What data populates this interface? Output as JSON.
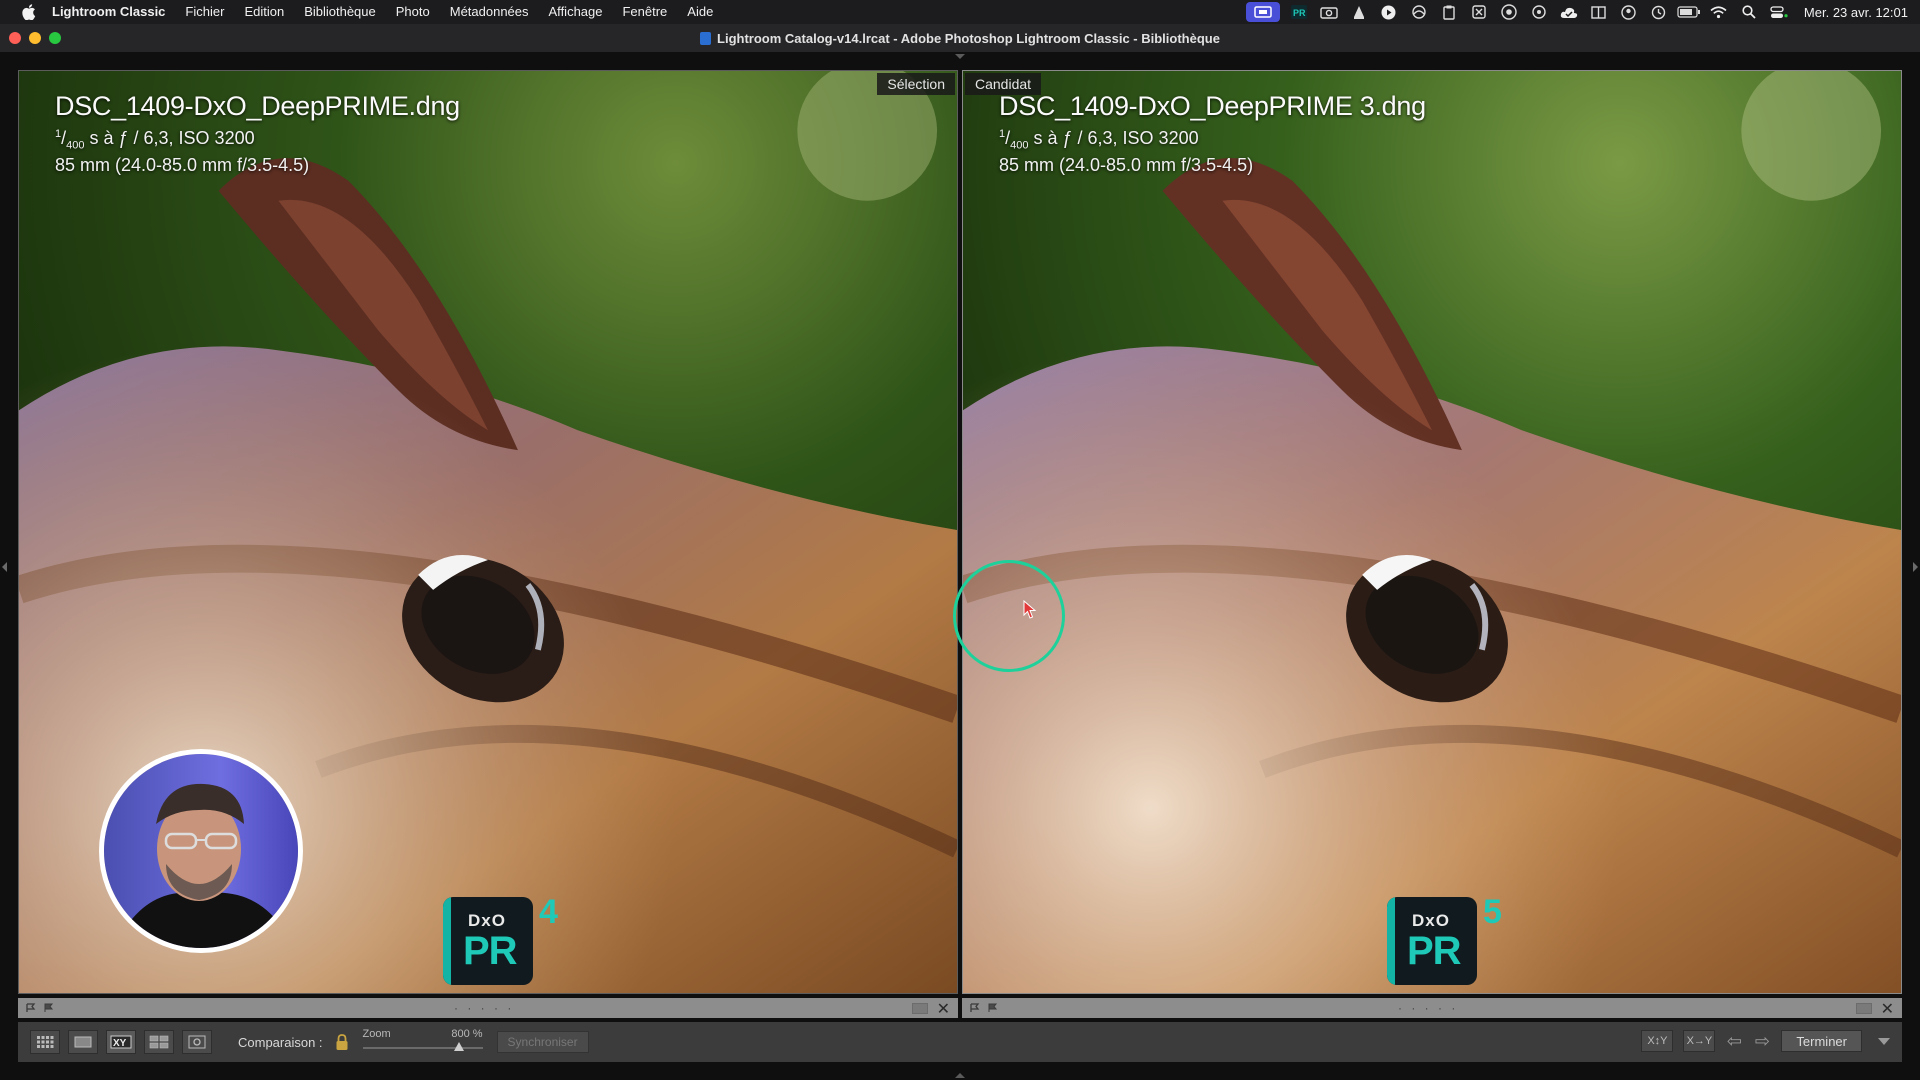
{
  "menubar": {
    "app_name": "Lightroom Classic",
    "items": [
      "Fichier",
      "Edition",
      "Bibliothèque",
      "Photo",
      "Métadonnées",
      "Affichage",
      "Fenêtre",
      "Aide"
    ],
    "clock": "Mer. 23 avr. 12:01"
  },
  "window": {
    "title": "Lightroom Catalog-v14.lrcat - Adobe Photoshop Lightroom Classic - Bibliothèque"
  },
  "left_panel": {
    "tag": "Sélection",
    "filename": "DSC_1409-DxO_DeepPRIME.dng",
    "exposure_denominator": "400",
    "exposure_rest": " s à ƒ / 6,3, ISO 3200",
    "lens": "85 mm (24.0-85.0 mm f/3.5-4.5)",
    "logo_brand": "DxO",
    "logo_product": "PR",
    "logo_version": "4"
  },
  "right_panel": {
    "tag": "Candidat",
    "filename": "DSC_1409-DxO_DeepPRIME 3.dng",
    "exposure_denominator": "400",
    "exposure_rest": " s à ƒ / 6,3, ISO 3200",
    "lens": "85 mm (24.0-85.0 mm f/3.5-4.5)",
    "logo_brand": "DxO",
    "logo_product": "PR",
    "logo_version": "5"
  },
  "strip": {
    "dots": "· · · · ·"
  },
  "toolbar": {
    "compare_label": "Comparaison :",
    "zoom_label": "Zoom",
    "zoom_value": "800 %",
    "zoom_fraction": 0.8,
    "sync_label": "Synchroniser",
    "swap_label": "X↕Y",
    "select_label": "X→Y",
    "done_label": "Terminer"
  },
  "colors": {
    "accent_teal": "#1fc9b8",
    "cursor_ring": "#1ed19a",
    "menubar_active": "#4a4fd8"
  }
}
